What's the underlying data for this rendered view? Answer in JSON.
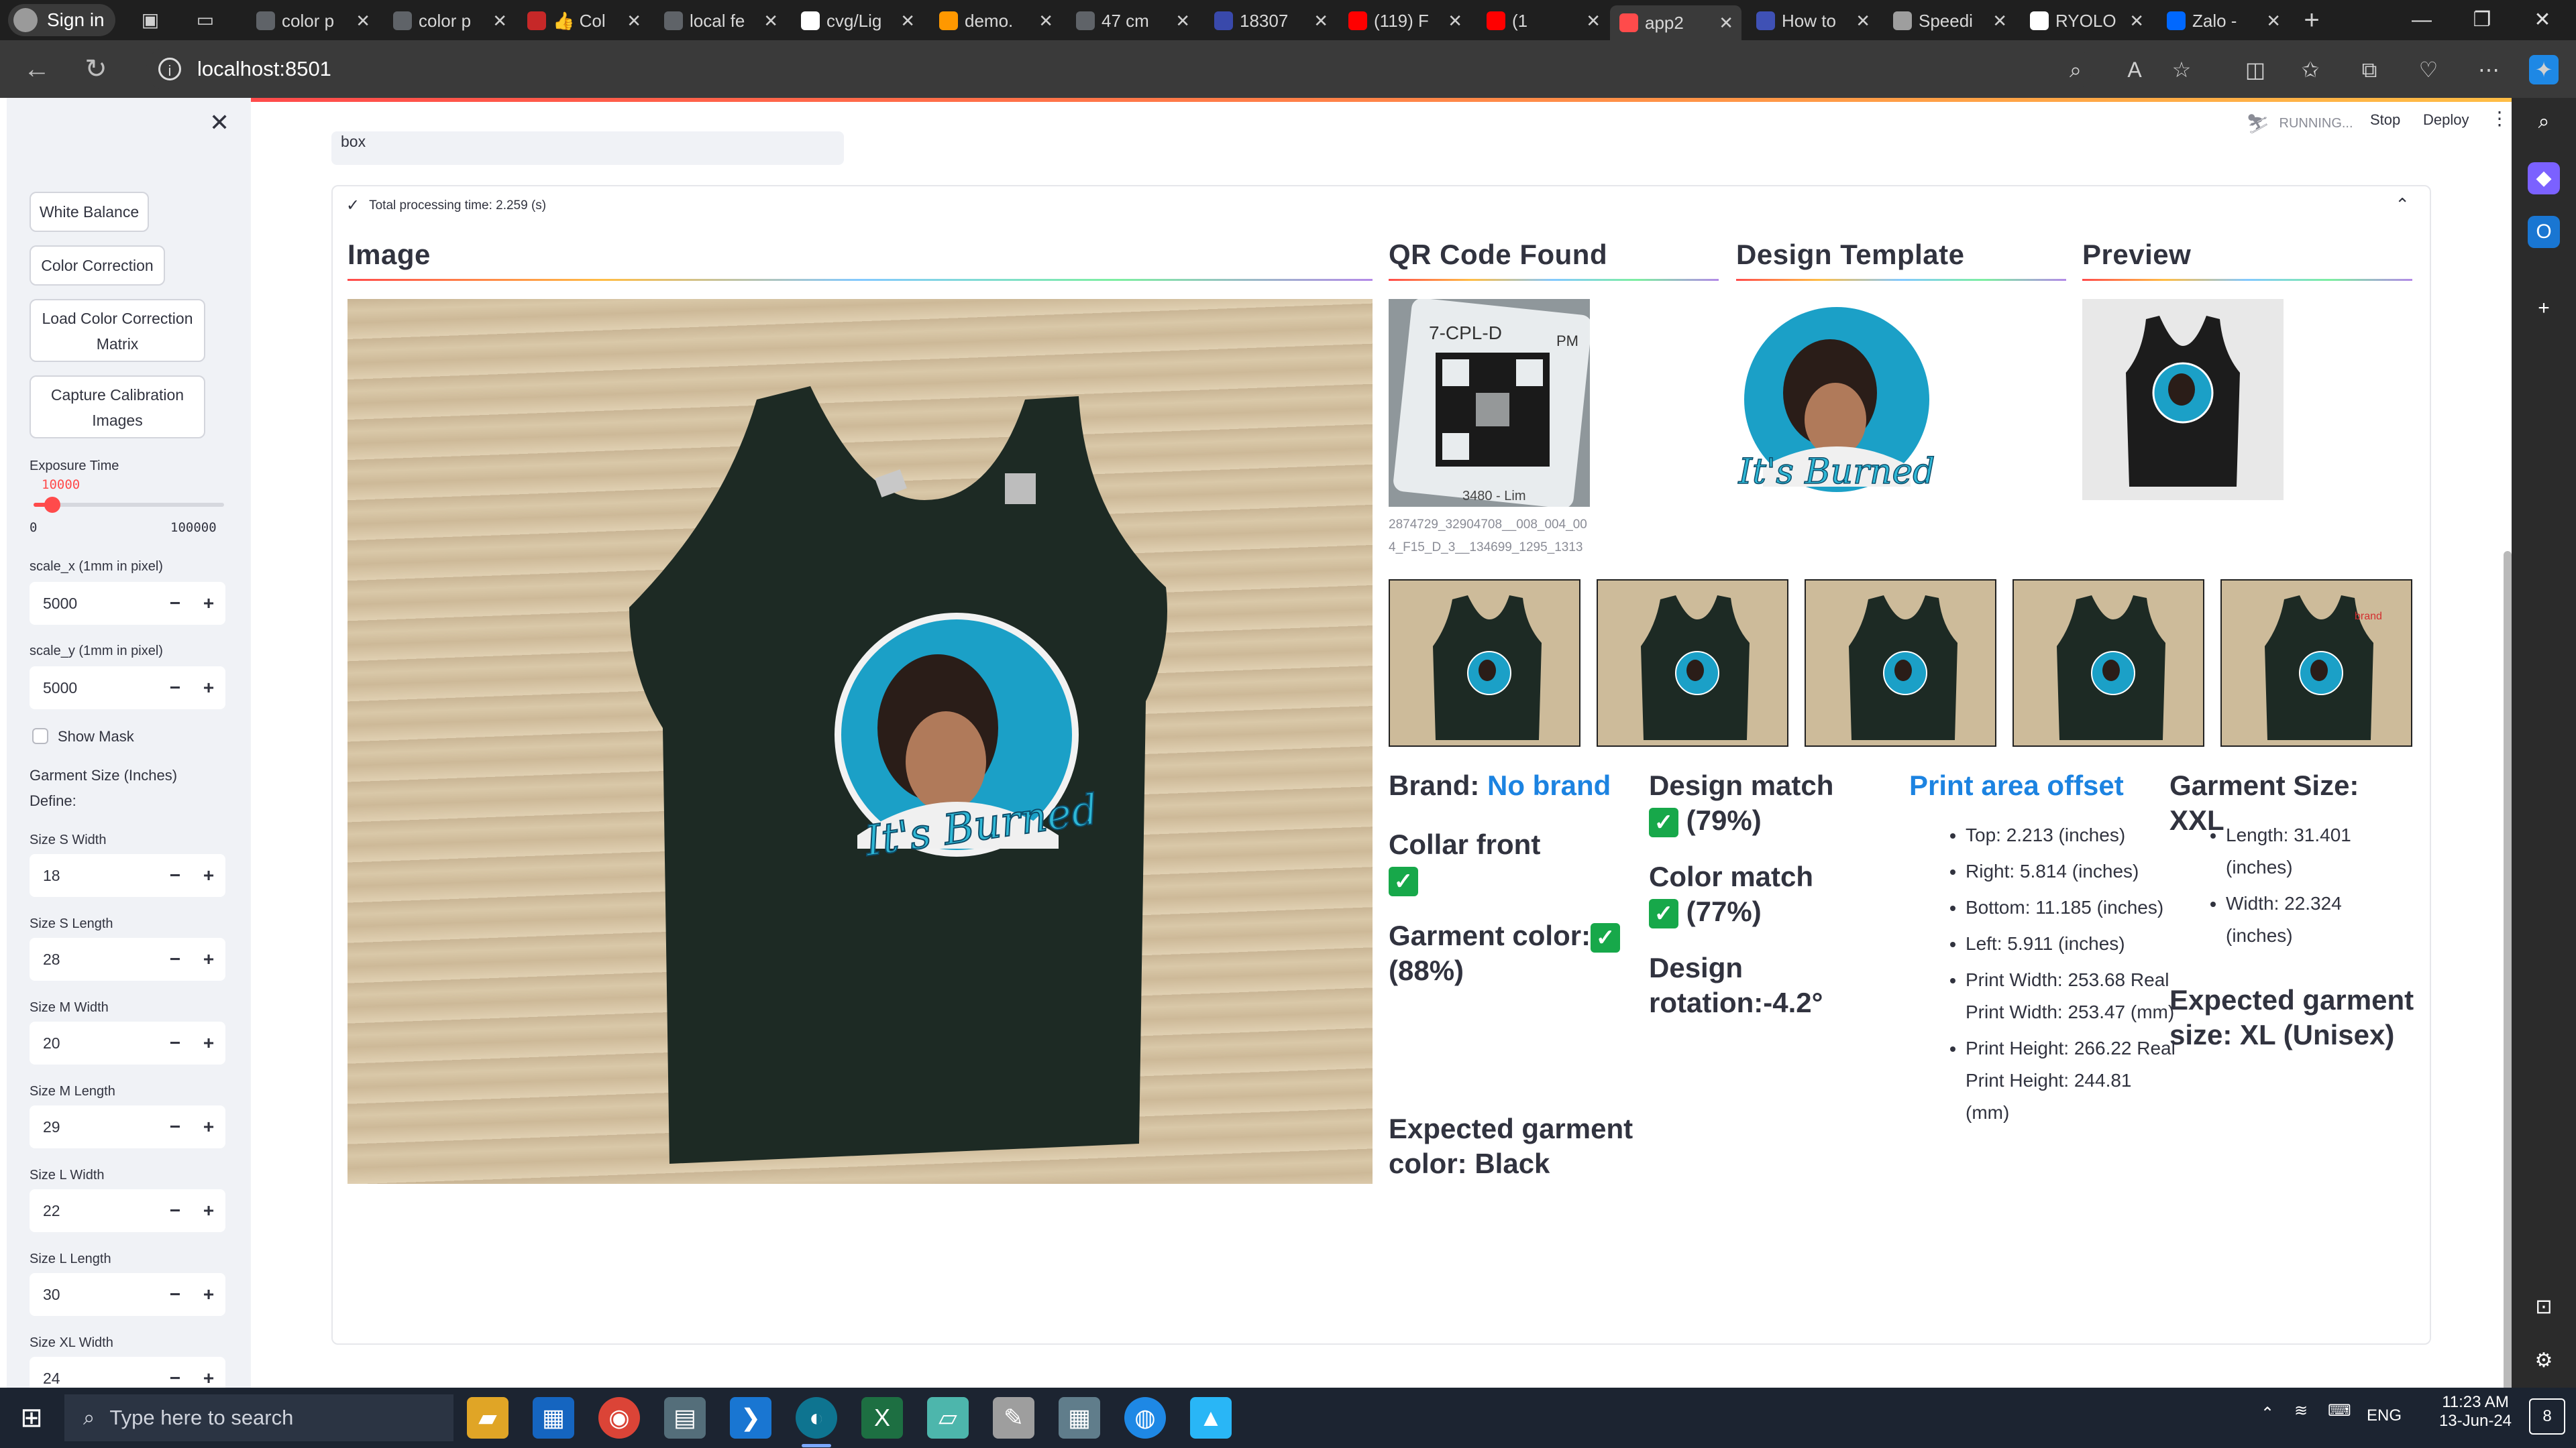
{
  "browser": {
    "profile_label": "Sign in",
    "tabs": [
      {
        "title": "color p",
        "icon": "chrome-icon",
        "color": "#5f6368"
      },
      {
        "title": "color p",
        "icon": "chrome-icon",
        "color": "#5f6368"
      },
      {
        "title": "👍 Col",
        "icon": "app-icon",
        "color": "#c62828"
      },
      {
        "title": "local fe",
        "icon": "chrome-icon",
        "color": "#5f6368"
      },
      {
        "title": "cvg/Lig",
        "icon": "github-icon",
        "color": "#ffffff"
      },
      {
        "title": "demo.",
        "icon": "loop-icon",
        "color": "#ff9800"
      },
      {
        "title": "47 cm",
        "icon": "chrome-icon",
        "color": "#5f6368"
      },
      {
        "title": "18307",
        "icon": "doc-icon",
        "color": "#3949ab"
      },
      {
        "title": "(119) F",
        "icon": "youtube-icon",
        "color": "#ff0000"
      },
      {
        "title": "(1",
        "icon": "youtube-icon",
        "color": "#ff0000"
      },
      {
        "title": "app2",
        "icon": "streamlit-icon",
        "color": "#ff4b4b",
        "active": true
      },
      {
        "title": "How to",
        "icon": "vscode-icon",
        "color": "#3f51b5"
      },
      {
        "title": "Speedi",
        "icon": "spinner-icon",
        "color": "#9e9e9e"
      },
      {
        "title": "RYOLO",
        "icon": "github-icon",
        "color": "#ffffff"
      },
      {
        "title": "Zalo -",
        "icon": "zalo-icon",
        "color": "#0068ff"
      }
    ],
    "url": "localhost:8501"
  },
  "app": {
    "status": "RUNNING...",
    "stop_label": "Stop",
    "deploy_label": "Deploy",
    "accent_color": "#ff4b4b"
  },
  "sidebar": {
    "buttons": {
      "white_balance": "White Balance",
      "color_correction": "Color Correction",
      "load_ccm_1": "Load Color Correction",
      "load_ccm_2": "Matrix",
      "capture_1": "Capture Calibration",
      "capture_2": "Images"
    },
    "exposure": {
      "label": "Exposure Time",
      "value": "10000",
      "min": "0",
      "max": "100000",
      "fraction": 0.1
    },
    "scale_x": {
      "label": "scale_x (1mm in pixel)",
      "value": "5000"
    },
    "scale_y": {
      "label": "scale_y (1mm in pixel)",
      "value": "5000"
    },
    "show_mask": "Show Mask",
    "garment_size_title": "Garment Size (Inches)",
    "define_label": "Define:",
    "sizes": [
      {
        "label": "Size S Width",
        "value": "18"
      },
      {
        "label": "Size S Length",
        "value": "28"
      },
      {
        "label": "Size M Width",
        "value": "20"
      },
      {
        "label": "Size M Length",
        "value": "29"
      },
      {
        "label": "Size L Width",
        "value": "22"
      },
      {
        "label": "Size L Length",
        "value": "30"
      },
      {
        "label": "Size XL Width",
        "value": "24"
      }
    ],
    "minus": "−",
    "plus": "+"
  },
  "main": {
    "input_value": "box",
    "expander_title": "Total processing time: 2.259 (s)",
    "columns": {
      "image": "Image",
      "qr": "QR Code Found",
      "design": "Design Template",
      "preview": "Preview"
    },
    "qr_caption": "2874729_32904708__008_004_004_F15_D_3__134699_1295_1313",
    "qr_text_top": "7-CPL-D",
    "qr_text_side": "PM",
    "qr_text_bottom": "3480 - Lim",
    "design_text": "It's Burned",
    "thumb_labels": [
      "",
      "",
      "",
      "",
      "brand"
    ],
    "info": {
      "brand_label": "Brand: ",
      "brand_value": "No brand",
      "collar": "Collar front",
      "garment_color_label": "Garment color:",
      "garment_color_pct": "(88%)",
      "expected_color": "Expected garment color: Black",
      "design_match": "Design match",
      "design_match_pct": "(79%)",
      "color_match": "Color match",
      "color_match_pct": "(77%)",
      "design_rotation": "Design rotation:-4.2°",
      "offset_title": "Print area offset",
      "offsets": [
        "Top: 2.213 (inches)",
        "Right: 5.814 (inches)",
        "Bottom: 11.185 (inches)",
        "Left: 5.911 (inches)",
        "Print Width: 253.68 Real Print Width: 253.47 (mm)",
        "Print Height: 266.22 Real Print Height: 244.81 (mm)"
      ],
      "garment_size": "Garment Size: XXL",
      "garment_dims": [
        "Length: 31.401 (inches)",
        "Width: 22.324 (inches)"
      ],
      "expected_size": "Expected garment size: XL (Unisex)"
    }
  },
  "taskbar": {
    "search_placeholder": "Type here to search",
    "lang": "ENG",
    "time": "11:23 AM",
    "date": "13-Jun-24",
    "notif_count": "8"
  }
}
